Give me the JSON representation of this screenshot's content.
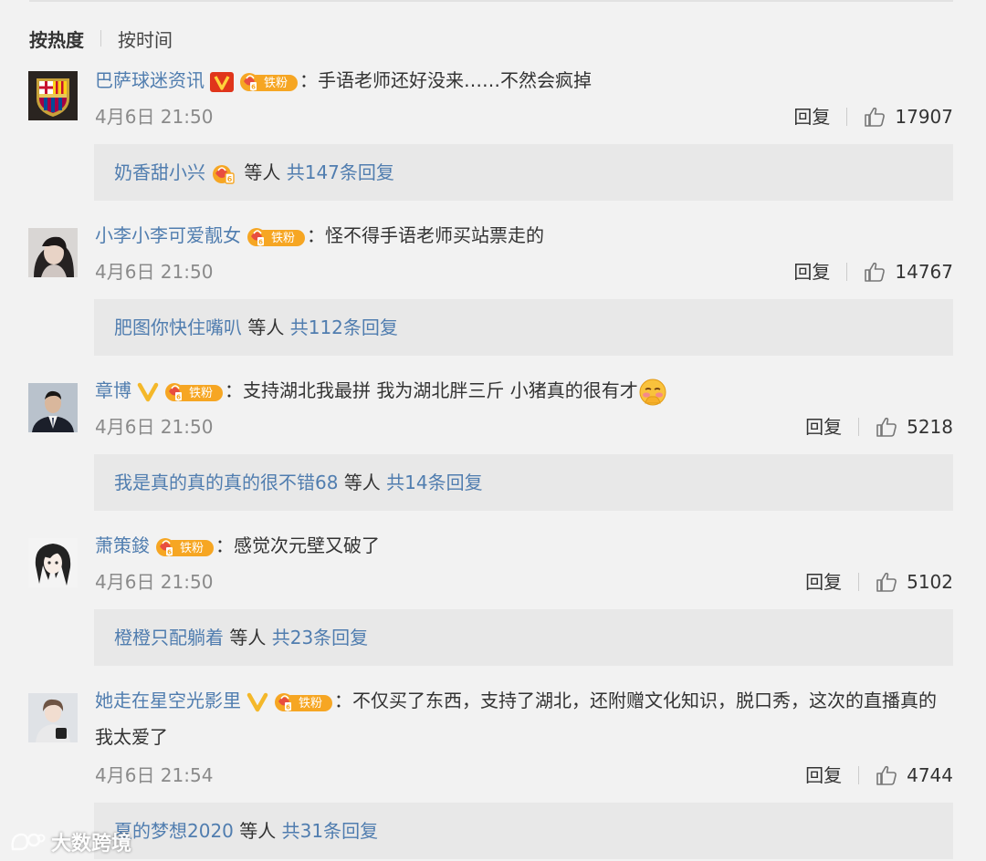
{
  "sort_tabs": {
    "hot": "按热度",
    "time": "按时间"
  },
  "comments": [
    {
      "username": "巴萨球迷资讯",
      "verified": true,
      "verified_color": "#e0351b",
      "fan_badge": "铁粉",
      "separator": "：",
      "text": "手语老师还好没来……不然会疯掉",
      "timestamp": "4月6日 21:50",
      "reply_label": "回复",
      "likes": "17907",
      "reply_preview": {
        "user": "奶香甜小兴",
        "has_fan_badge": true,
        "mid": "等人",
        "total": "共147条回复"
      }
    },
    {
      "username": "小李小李可爱靓女",
      "verified": false,
      "fan_badge": "铁粉",
      "separator": "：",
      "text": "怪不得手语老师买站票走的",
      "timestamp": "4月6日 21:50",
      "reply_label": "回复",
      "likes": "14767",
      "reply_preview": {
        "user": "肥图你快住嘴叭",
        "has_fan_badge": false,
        "mid": "等人",
        "total": "共112条回复"
      }
    },
    {
      "username": "章博",
      "verified": true,
      "verified_color": "#f4b82a",
      "fan_badge": "铁粉",
      "separator": "：",
      "text": "支持湖北我最拼 我为湖北胖三斤  小猪真的很有才",
      "emoji": "shy-face-emoji",
      "timestamp": "4月6日 21:50",
      "reply_label": "回复",
      "likes": "5218",
      "reply_preview": {
        "user": "我是真的真的真的很不错68",
        "has_fan_badge": false,
        "mid": "等人",
        "total": "共14条回复"
      }
    },
    {
      "username": "萧策鋑",
      "verified": false,
      "fan_badge": "铁粉",
      "separator": "：",
      "text": "感觉次元壁又破了",
      "timestamp": "4月6日 21:50",
      "reply_label": "回复",
      "likes": "5102",
      "reply_preview": {
        "user": "橙橙只配躺着",
        "has_fan_badge": false,
        "mid": "等人",
        "total": "共23条回复"
      }
    },
    {
      "username": "她走在星空光影里",
      "verified": true,
      "verified_color": "#f4b82a",
      "fan_badge": "铁粉",
      "separator": "：",
      "text": "不仅买了东西，支持了湖北，还附赠文化知识，脱口秀，这次的直播真的我太爱了",
      "timestamp": "4月6日 21:54",
      "reply_label": "回复",
      "likes": "4744",
      "reply_preview": {
        "user": "夏的梦想2020",
        "has_fan_badge": false,
        "mid": "等人",
        "total": "共31条回复"
      }
    }
  ],
  "watermark": {
    "text": "大数跨境",
    "logo": "dashu-logo-icon"
  },
  "colors": {
    "username": "#507daf",
    "background": "#f2f2f2",
    "reply_box": "#e8e8e8",
    "fan_badge": "#f6a623"
  }
}
